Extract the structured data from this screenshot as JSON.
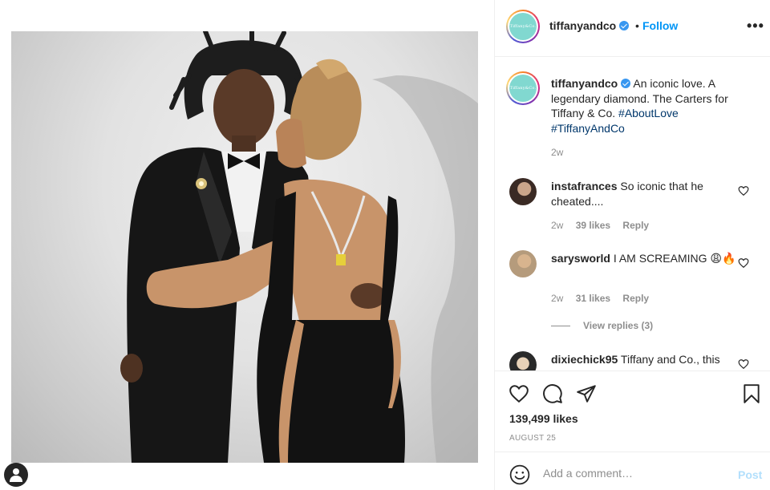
{
  "post": {
    "username": "tiffanyandco",
    "verified": true,
    "dot": "•",
    "follow_label": "Follow",
    "more_label": "•••",
    "avatar_text": "Tiffany&Co.",
    "brand_color": "#81d8d0",
    "accent_color": "#0095f6"
  },
  "caption": {
    "username": "tiffanyandco",
    "text": "An iconic love. A legendary diamond. The Carters for Tiffany & Co.",
    "hashtags": [
      "#AboutLove",
      "#TiffanyAndCo"
    ],
    "time": "2w"
  },
  "comments": [
    {
      "username": "instafrances",
      "text": "So iconic that he cheated....",
      "time": "2w",
      "likes": "39 likes",
      "reply": "Reply"
    },
    {
      "username": "sarysworld",
      "text": "I AM SCREAMING 😩🔥",
      "time": "2w",
      "likes": "31 likes",
      "reply": "Reply",
      "view_replies": "View replies (3)"
    },
    {
      "username": "dixiechick95",
      "text": "Tiffany and Co., this"
    }
  ],
  "actions": {
    "like_icon": "heart-icon",
    "comment_icon": "comment-icon",
    "share_icon": "share-icon",
    "save_icon": "bookmark-icon",
    "likes": "139,499 likes",
    "date": "AUGUST 25"
  },
  "add_comment": {
    "placeholder": "Add a comment…",
    "post_label": "Post",
    "emoji_icon": "smiley-icon"
  }
}
